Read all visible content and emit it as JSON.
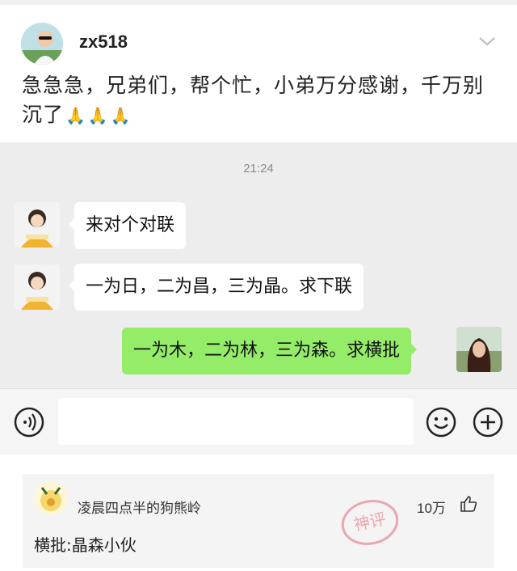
{
  "post": {
    "username": "zx518",
    "text": "急急急，兄弟们，帮个忙，小弟万分感谢，千万别沉了",
    "emojis": [
      "🙏",
      "🙏",
      "🙏"
    ],
    "avatar_icon": "user-avatar-photo",
    "menu_icon": "chevron-down-icon"
  },
  "chat": {
    "time": "21:24",
    "messages": [
      {
        "side": "left",
        "text": "来对个对联"
      },
      {
        "side": "left",
        "text": "一为日，二为昌，三为晶。求下联"
      },
      {
        "side": "right",
        "text": "一为木，二为林，三为森。求横批"
      }
    ],
    "bubble_colors": {
      "left": "#ffffff",
      "right": "#95ec69"
    },
    "background": "#ededed"
  },
  "input_bar": {
    "voice_icon": "voice-icon",
    "emoji_icon": "emoji-icon",
    "add_icon": "plus-icon"
  },
  "comment": {
    "name": "凌晨四点半的狗熊岭",
    "likes": "10万",
    "text": "横批:晶森小伙",
    "stamp_text": "神评",
    "like_icon": "thumbs-up-icon"
  }
}
